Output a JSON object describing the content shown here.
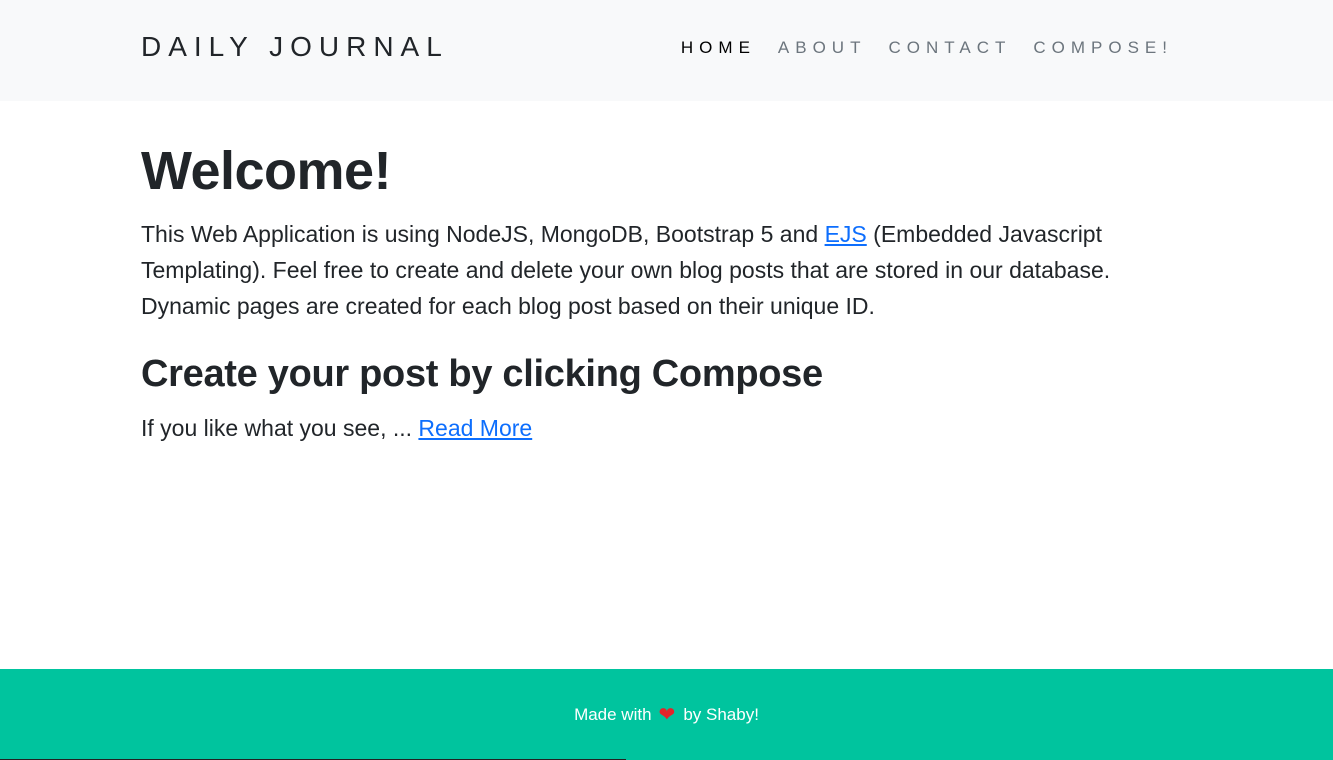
{
  "navbar": {
    "brand": "DAILY JOURNAL",
    "items": [
      {
        "label": "HOME",
        "active": true
      },
      {
        "label": "ABOUT",
        "active": false
      },
      {
        "label": "CONTACT",
        "active": false
      },
      {
        "label": "COMPOSE!",
        "active": false
      }
    ]
  },
  "main": {
    "title": "Welcome!",
    "intro_before_link": "This Web Application is using NodeJS, MongoDB, Bootstrap 5 and ",
    "intro_link": "EJS",
    "intro_after_link": " (Embedded Javascript Templating). Feel free to create and delete your own blog posts that are stored in our database. Dynamic pages are created for each blog post based on their unique ID.",
    "post": {
      "title": "Create your post by clicking Compose",
      "excerpt": "If you like what you see, ... ",
      "read_more": "Read More"
    }
  },
  "footer": {
    "text_before": "Made with",
    "icon": "heart-icon",
    "text_after": "by Shaby!"
  },
  "colors": {
    "navbar_bg": "#f8f9fa",
    "footer_bg": "#00c49e",
    "link": "#0d6efd",
    "heart": "#e2242a"
  }
}
